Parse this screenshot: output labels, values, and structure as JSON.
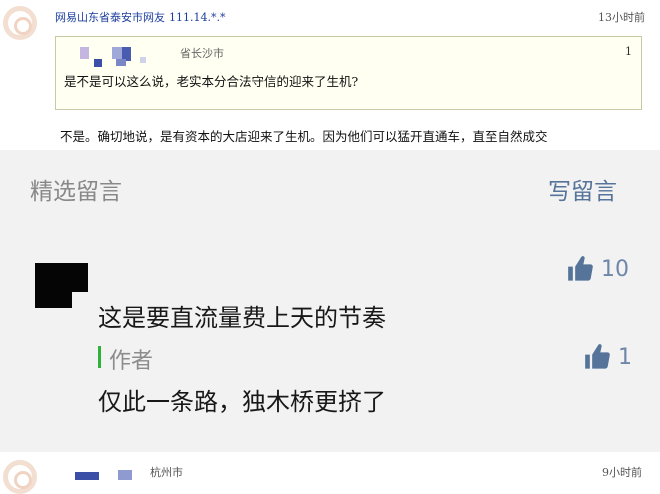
{
  "forum": {
    "post1": {
      "user": "网易山东省泰安市网友",
      "ip": "111.14.*.*",
      "time": "13小时前",
      "quote": {
        "location": "省长沙市",
        "floor": "1",
        "text": "是不是可以这么说，老实本分合法守信的迎来了生机?"
      },
      "reply": "不是。确切地说，是有资本的大店迎来了生机。因为他们可以猛开直通车，直至自然成交"
    },
    "post2": {
      "location": "杭州市",
      "time": "9小时前"
    }
  },
  "comments": {
    "title": "精选留言",
    "write_button": "写留言",
    "top_comment": {
      "text": "这是要直流量费上天的节奏",
      "likes": "10"
    },
    "author_reply": {
      "label": "作者",
      "text": "仅此一条路，独木桥更挤了",
      "likes": "1"
    }
  },
  "colors": {
    "panel_bg": "#f2f2f2",
    "link_blue": "#56739a",
    "author_green": "#2fb13a",
    "quote_bg": "#fffff2"
  },
  "icons": [
    "thumbs-up-icon",
    "avatar-watermark-icon"
  ]
}
